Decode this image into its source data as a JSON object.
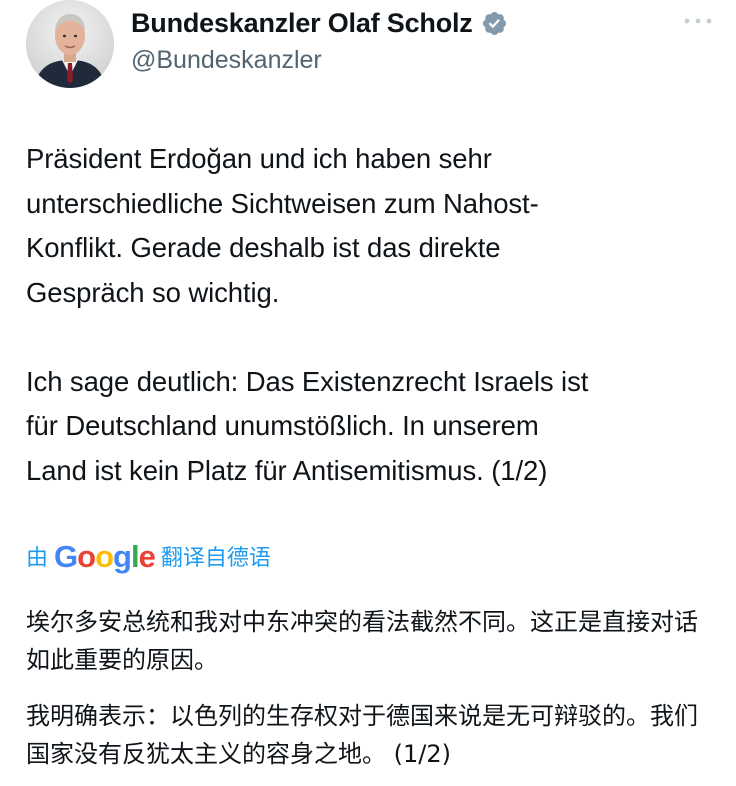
{
  "author": {
    "display_name": "Bundeskanzler Olaf Scholz",
    "handle": "@Bundeskanzler",
    "verified": true,
    "avatar_icon": "avatar-photo",
    "verified_color": "#829aab"
  },
  "tweet": {
    "text": "Präsident Erdoğan und ich haben sehr\nunterschiedliche Sichtweisen zum Nahost-\nKonflikt. Gerade deshalb ist das direkte\nGespräch so wichtig.\n\nIch sage deutlich: Das Existenzrecht Israels ist\nfür Deutschland unumstößlich. In unserem\nLand ist kein Platz für Antisemitismus. (1/2)"
  },
  "translation": {
    "prefix": "由",
    "provider": "Google",
    "suffix": "翻译自德语",
    "link_color": "#1d9bf0",
    "paragraph_1": "埃尔多安总统和我对中东冲突的看法截然不同。这正是直接对话如此重要的原因。",
    "paragraph_2": "我明确表示：以色列的生存权对于德国来说是无可辩驳的。我们国家没有反犹太主义的容身之地。 (1/2)"
  }
}
